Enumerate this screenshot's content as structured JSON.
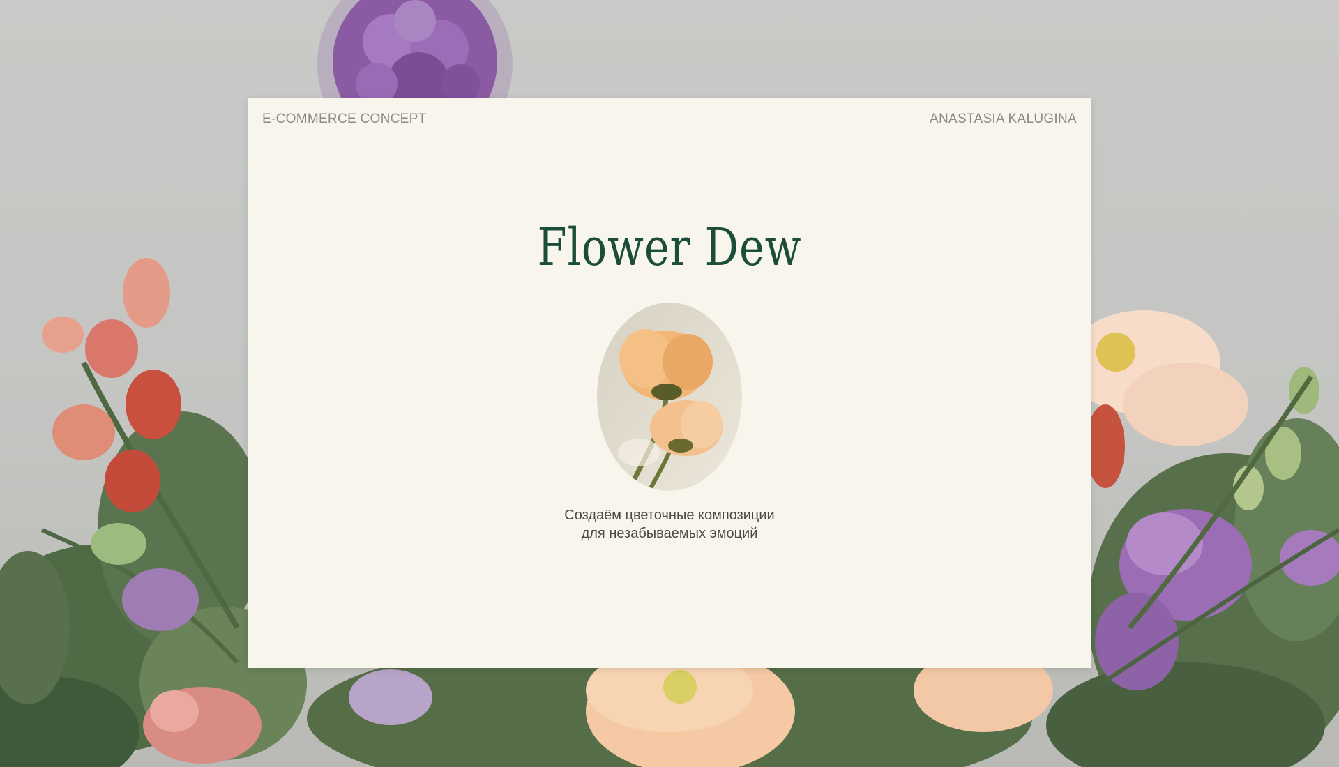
{
  "header": {
    "left_label": "E-COMMERCE CONCEPT",
    "right_label": "ANASTASIA KALUGINA"
  },
  "hero": {
    "title": "Flower Dew",
    "tagline_line1": "Создаём цветочные композиции",
    "tagline_line2": "для незабываемых эмоций",
    "image_icon": "poppy-flower-photo"
  },
  "background": {
    "image_icon": "flower-bouquet-photo"
  },
  "colors": {
    "card_background": "#f7f5ec",
    "title_green": "#1c4d3a",
    "label_gray": "#8a8a86",
    "text_dark": "#4a4a46",
    "page_gray": "#c6c7c4"
  }
}
